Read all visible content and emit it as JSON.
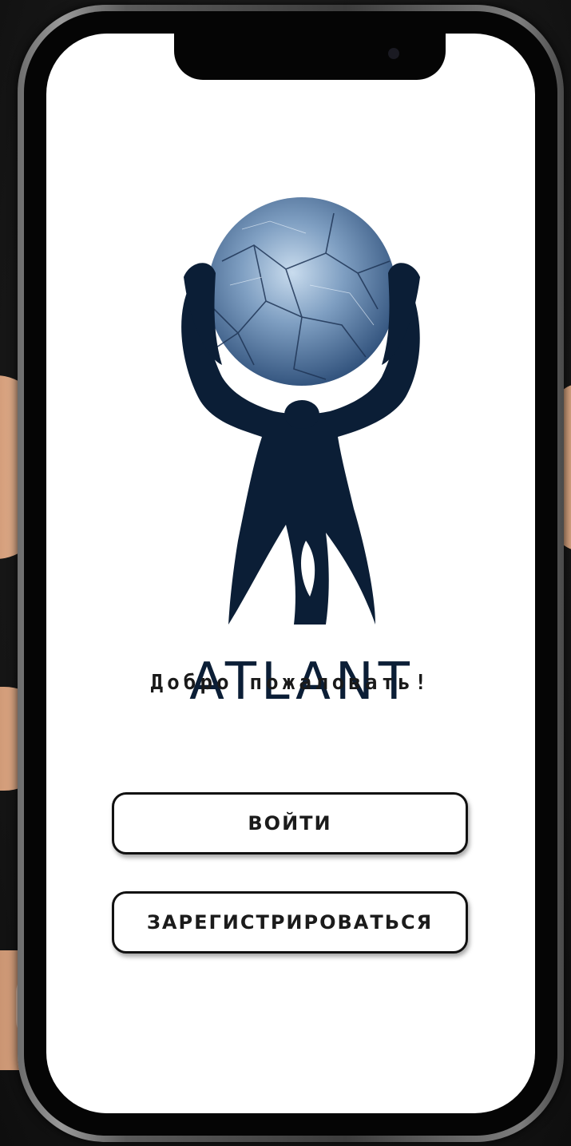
{
  "app": {
    "brand_text": "ATLANT",
    "welcome_text": "Добро пожаловать!"
  },
  "buttons": {
    "login_label": "ВОЙТИ",
    "register_label": "ЗАРЕГИСТРИРОВАТЬСЯ"
  },
  "colors": {
    "brand_navy": "#0b1e36",
    "globe_blue": "#5b7ea6",
    "screen_bg": "#ffffff",
    "button_border": "#111111"
  },
  "icons": {
    "logo": "atlas-holding-globe-icon",
    "camera": "front-camera-icon"
  }
}
